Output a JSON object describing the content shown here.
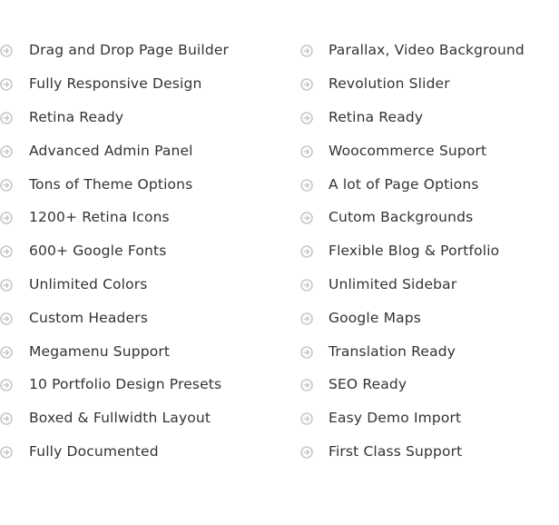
{
  "colors": {
    "text": "#333333",
    "icon": "#c8c8c8",
    "background": "#ffffff"
  },
  "icon_name": "arrow-circle-right-icon",
  "features": {
    "left": [
      {
        "label": "Drag and Drop Page Builder"
      },
      {
        "label": "Fully Responsive Design"
      },
      {
        "label": "Retina Ready"
      },
      {
        "label": "Advanced Admin Panel"
      },
      {
        "label": "Tons of Theme Options"
      },
      {
        "label": "1200+ Retina Icons"
      },
      {
        "label": "600+ Google Fonts"
      },
      {
        "label": "Unlimited Colors"
      },
      {
        "label": "Custom Headers"
      },
      {
        "label": "Megamenu Support"
      },
      {
        "label": "10 Portfolio Design Presets"
      },
      {
        "label": "Boxed & Fullwidth Layout"
      },
      {
        "label": "Fully Documented"
      }
    ],
    "right": [
      {
        "label": "Parallax, Video Background"
      },
      {
        "label": "Revolution Slider"
      },
      {
        "label": "Retina Ready"
      },
      {
        "label": "Woocommerce Suport"
      },
      {
        "label": "A lot of Page Options"
      },
      {
        "label": "Cutom Backgrounds"
      },
      {
        "label": "Flexible Blog & Portfolio"
      },
      {
        "label": "Unlimited Sidebar"
      },
      {
        "label": "Google Maps"
      },
      {
        "label": "Translation Ready"
      },
      {
        "label": "SEO Ready"
      },
      {
        "label": "Easy Demo Import"
      },
      {
        "label": "First Class Support"
      }
    ]
  }
}
